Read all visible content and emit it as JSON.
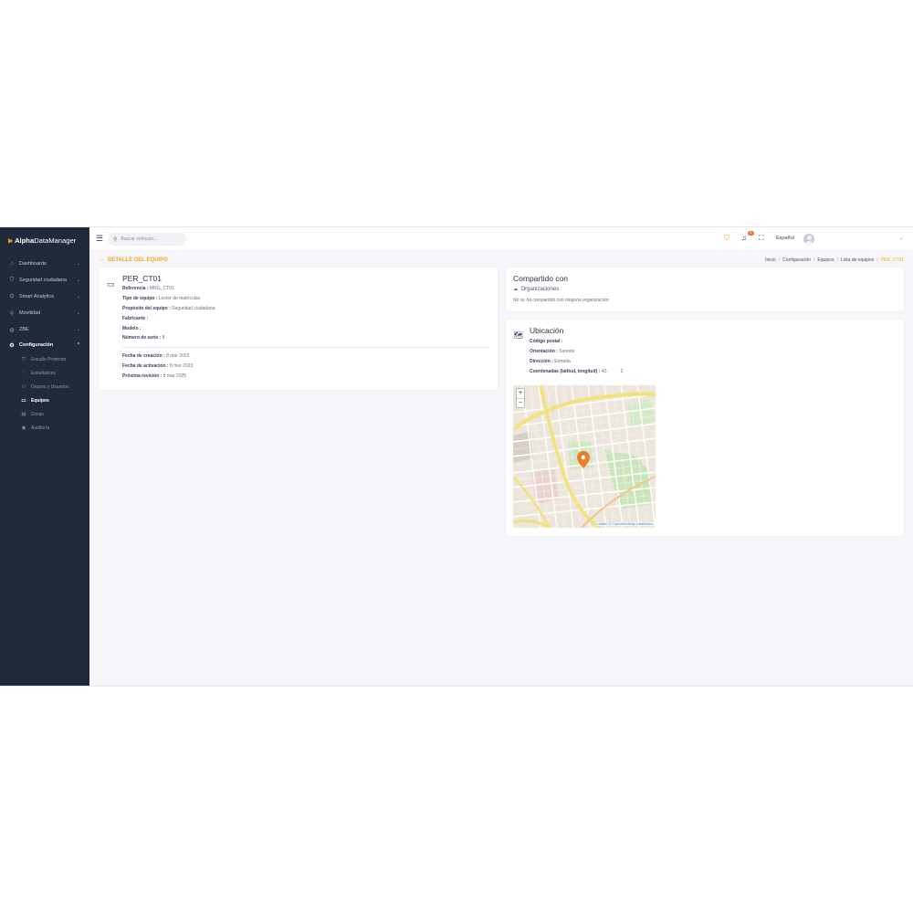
{
  "app": {
    "logo_mark": "⫸",
    "logo_bold": "Alpha",
    "logo_rest": "DataManager"
  },
  "sidebar": {
    "items": [
      {
        "label": "Dashboards",
        "icon": "home-icon"
      },
      {
        "label": "Seguridad ciudadana",
        "icon": "shield-icon"
      },
      {
        "label": "Smart Analytics",
        "icon": "analytics-icon"
      },
      {
        "label": "Movilidad",
        "icon": "pin-icon"
      },
      {
        "label": "ZBE",
        "icon": "zbe-icon"
      },
      {
        "label": "Configuración",
        "icon": "gear-icon"
      }
    ],
    "subitems": [
      {
        "label": "Escudo Protector",
        "icon": "shield-outline-icon"
      },
      {
        "label": "Estadísticas",
        "icon": "chart-icon"
      },
      {
        "label": "Grupos y Usuarios",
        "icon": "users-icon"
      },
      {
        "label": "Equipos",
        "icon": "camera-icon"
      },
      {
        "label": "Zonas",
        "icon": "zone-icon"
      },
      {
        "label": "Auditoría",
        "icon": "eye-icon"
      }
    ]
  },
  "header": {
    "search_placeholder": "Buscar vehículo...",
    "notification_count": "4",
    "language": "Español"
  },
  "page": {
    "title": "DETALLE DEL EQUIPO",
    "breadcrumb": [
      "Inicio",
      "Configuración",
      "Equipos",
      "Lista de equipos",
      "PER_CT01"
    ]
  },
  "equipo": {
    "name": "PER_CT01",
    "fields": [
      {
        "label": "Referencia :",
        "value": " MRG_CT01"
      },
      {
        "label": "Tipo de equipo :",
        "value": " Lector de matrículas"
      },
      {
        "label": "Propósito del equipo :",
        "value": " Seguridad ciudadana"
      },
      {
        "label": "Fabricante :",
        "value": ""
      },
      {
        "label": "Modelo :",
        "value": ""
      },
      {
        "label": "Número de serie :",
        "value": " 8"
      }
    ],
    "dates": [
      {
        "label": "Fecha de creación :",
        "value": " 8 mar 2023"
      },
      {
        "label": "Fecha de activación :",
        "value": " 8 mar 2023"
      },
      {
        "label": "Próxima revisión :",
        "value": " 8 mar 2025"
      }
    ]
  },
  "compartido": {
    "title": "Compartido con",
    "orgs_label": "Organizaciones",
    "empty_text": "No se ha compartido con ninguna organización."
  },
  "ubicacion": {
    "title": "Ubicación",
    "fields": [
      {
        "label": "Código postal :",
        "value": ""
      },
      {
        "label": "Orientación :",
        "value": " Sureste"
      },
      {
        "label": "Dirección :",
        "value": " Entrada"
      },
      {
        "label": "Coordenadas (latitud, longitud) :",
        "value": " 42.          2."
      }
    ],
    "map": {
      "zoom_in": "+",
      "zoom_out": "−",
      "attribution": "Leaflet | © OpenStreetMap contributors",
      "marker_color": "#ef7a2a"
    }
  },
  "colors": {
    "accent": "#f0a81a",
    "sidebar_bg": "#202a3d",
    "page_bg": "#f6f6fb"
  }
}
